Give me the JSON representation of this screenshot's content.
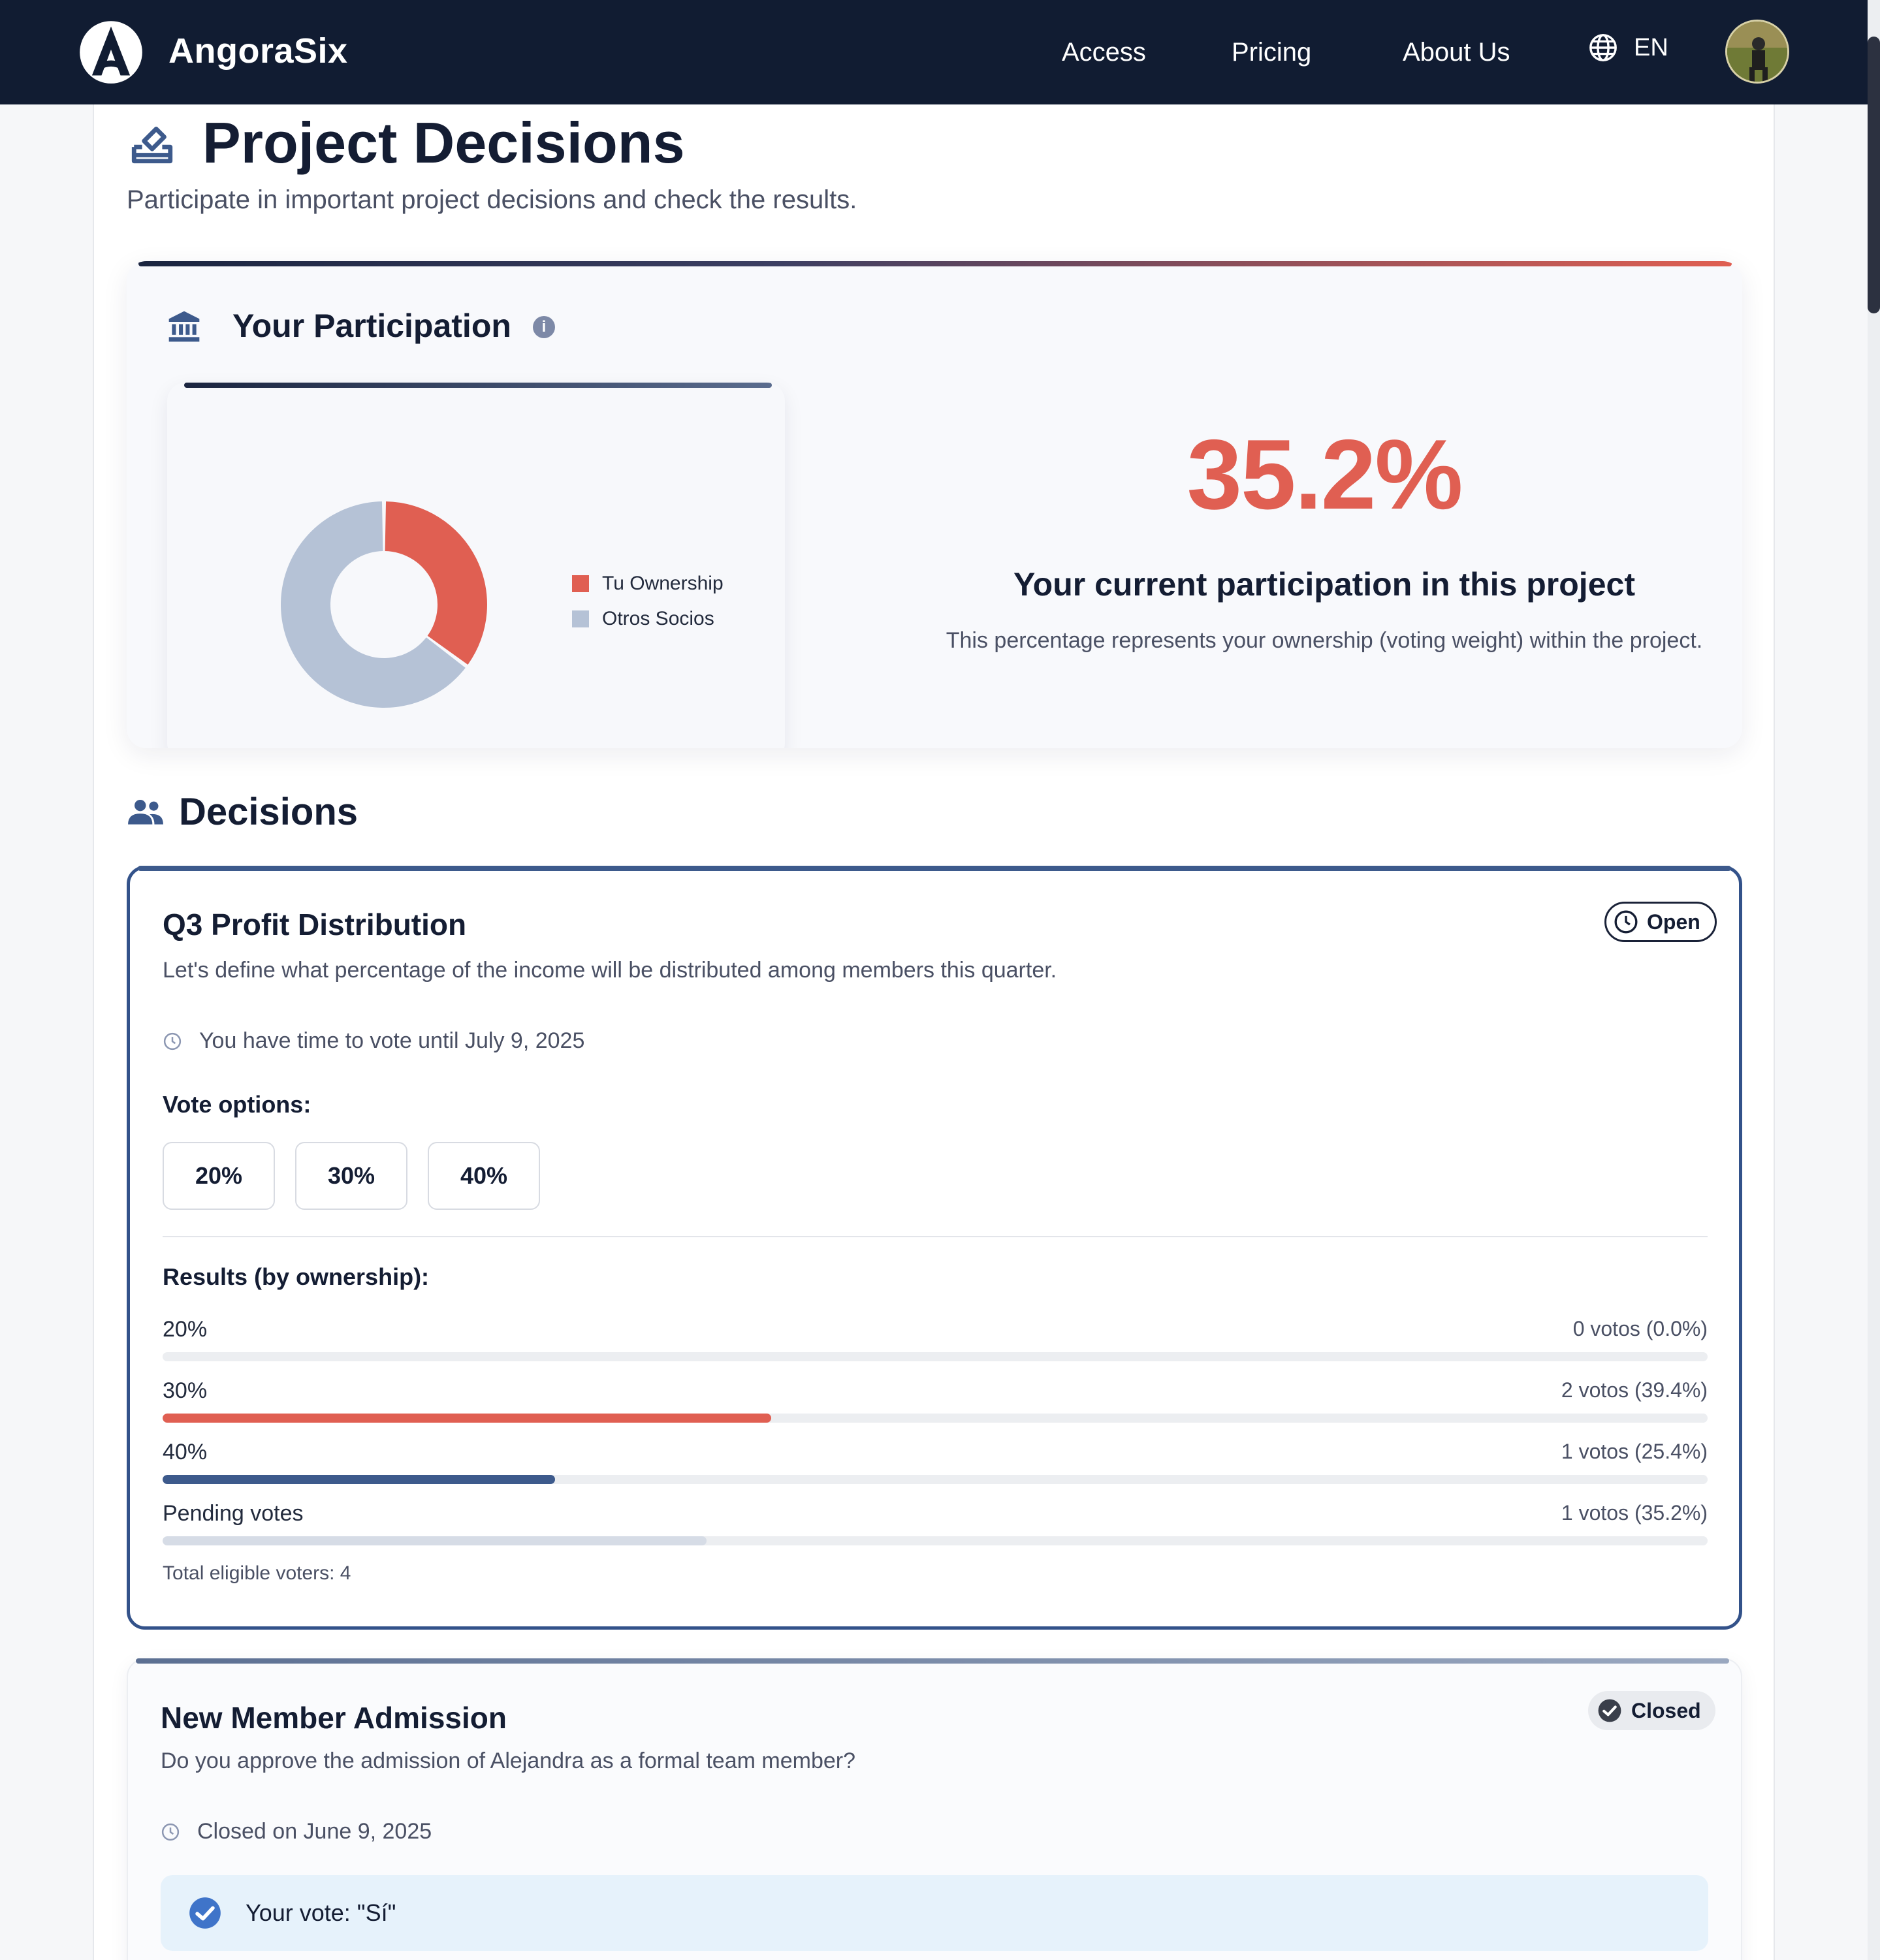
{
  "nav": {
    "brand": "AngoraSix",
    "links": [
      "Access",
      "Pricing",
      "About Us"
    ],
    "language": "EN"
  },
  "page": {
    "title": "Project Decisions",
    "subtitle": "Participate in important project decisions and check the results."
  },
  "participation": {
    "title": "Your Participation",
    "info_icon": "i",
    "percentage": "35.2%",
    "heading": "Your current participation in this project",
    "description": "This percentage represents your ownership (voting weight) within the project.",
    "colors": {
      "own": "#e05f52",
      "others": "#b5c2d6"
    }
  },
  "chart_data": {
    "type": "pie",
    "categories": [
      "Tu Ownership",
      "Otros Socios"
    ],
    "values": [
      35.2,
      64.8
    ],
    "legend_position": "right"
  },
  "decisions": {
    "title": "Decisions",
    "items": [
      {
        "title": "Q3 Profit Distribution",
        "status": "Open",
        "description": "Let's define what percentage of the income will be distributed among members this quarter.",
        "time_text": "You have time to vote until July 9, 2025",
        "vote_options_label": "Vote options:",
        "vote_options": [
          "20%",
          "30%",
          "40%"
        ],
        "results_label": "Results (by ownership):",
        "results": [
          {
            "name": "20%",
            "count": "0 votos (0.0%)",
            "fraction": 0.0,
            "color": "#e05f52"
          },
          {
            "name": "30%",
            "count": "2 votos (39.4%)",
            "fraction": 0.394,
            "color": "#e05f52"
          },
          {
            "name": "40%",
            "count": "1 votos (25.4%)",
            "fraction": 0.254,
            "color": "#3d5a8c"
          },
          {
            "name": "Pending votes",
            "count": "1 votos (35.2%)",
            "fraction": 0.352,
            "color": "#d6dce6"
          }
        ],
        "total": "Total eligible voters: 4"
      },
      {
        "title": "New Member Admission",
        "status": "Closed",
        "description": "Do you approve the admission of Alejandra as a formal team member?",
        "time_text": "Closed on June 9, 2025",
        "your_vote": "Your vote: \"Sí\""
      }
    ]
  }
}
